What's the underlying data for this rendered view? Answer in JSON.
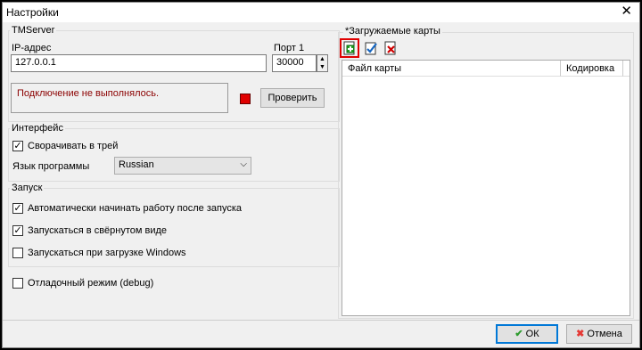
{
  "window": {
    "title": "Настройки"
  },
  "tmserver": {
    "group_label": "TMServer",
    "ip_label": "IP-адрес",
    "ip_value": "127.0.0.1",
    "port_label": "Порт 1",
    "port_value": "30000",
    "status_text": "Подключение не выполнялось.",
    "status_color": "#e00000",
    "check_button": "Проверить"
  },
  "interface": {
    "group_label": "Интерфейс",
    "minimize_to_tray_label": "Сворачивать в трей",
    "minimize_to_tray_checked": true,
    "language_label": "Язык программы",
    "language_value": "Russian"
  },
  "startup": {
    "group_label": "Запуск",
    "items": [
      {
        "label": "Автоматически начинать работу после запуска",
        "checked": true
      },
      {
        "label": "Запускаться в свёрнутом виде",
        "checked": true
      },
      {
        "label": "Запускаться при загрузке Windows",
        "checked": false
      }
    ]
  },
  "debug": {
    "label": "Отладочный режим (debug)",
    "checked": false
  },
  "maps": {
    "group_label": "*Загружаемые карты",
    "toolbar": [
      "add-map-icon",
      "edit-map-icon",
      "remove-map-icon"
    ],
    "columns": [
      "Файл карты",
      "Кодировка"
    ],
    "rows": []
  },
  "footer": {
    "ok_label": "ОК",
    "cancel_label": "Отмена"
  }
}
